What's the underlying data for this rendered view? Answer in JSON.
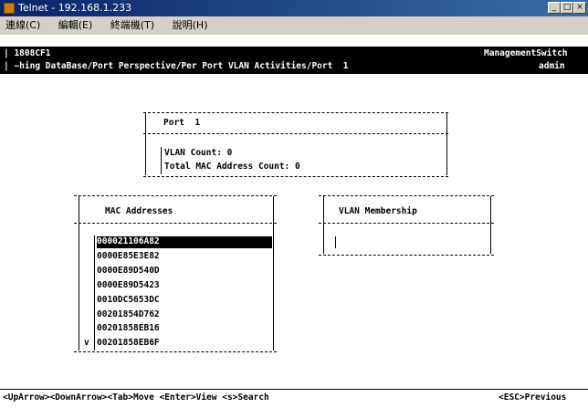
{
  "window": {
    "title": "Telnet - 192.168.1.233",
    "menu": [
      "連線(C)",
      "編輯(E)",
      "終端機(T)",
      "說明(H)"
    ],
    "buttons": [
      "_",
      "□",
      "×"
    ]
  },
  "header": {
    "device_id": "| 1808CF1",
    "path": "| ~hing DataBase/Port Perspective/Per Port VLAN Activities/Port  1",
    "switch_name": "ManagementSwitch",
    "user": "admin"
  },
  "port_box": {
    "port_label": "Port  1",
    "vlan_count": "VLAN Count: 0",
    "mac_count": "Total MAC Address Count: 0"
  },
  "mac_box": {
    "title": "MAC Addresses",
    "items": [
      "000021106A82",
      "0000E85E3E82",
      "0000E89D540D",
      "0000E89D5423",
      "0010DC5653DC",
      "00201854D762",
      "00201858EB16",
      "00201858EB6F"
    ],
    "scroll_indicator": "v"
  },
  "vlan_box": {
    "title": "VLAN Membership"
  },
  "footer": {
    "keys": "<UpArrow><DownArrow><Tab>Move <Enter>View <s>Search",
    "previous": "<ESC>Previous"
  }
}
